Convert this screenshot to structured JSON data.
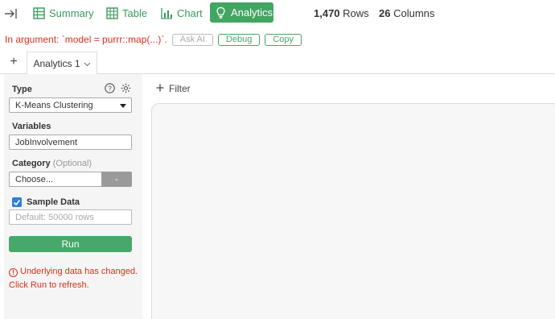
{
  "toolbar": {
    "collapse_icon": "collapse-right-icon",
    "views": [
      {
        "label": "Summary",
        "icon": "summary-icon"
      },
      {
        "label": "Table",
        "icon": "table-icon"
      },
      {
        "label": "Chart",
        "icon": "chart-icon"
      },
      {
        "label": "Analytics",
        "icon": "lightbulb-icon"
      }
    ],
    "rows_count": "1,470",
    "rows_label": "Rows",
    "cols_count": "26",
    "cols_label": "Columns",
    "accent_color": "#43a563"
  },
  "error": {
    "message": "In argument: `model = purrr::map(...)`.",
    "ask_ai_label": "Ask AI",
    "debug_label": "Debug",
    "copy_label": "Copy",
    "color": "#d7311d"
  },
  "tabs": {
    "add_label": "+",
    "items": [
      {
        "label": "Analytics 1"
      }
    ]
  },
  "panel": {
    "type_label": "Type",
    "type_value": "K-Means Clustering",
    "variables_label": "Variables",
    "variables_value": "JobInvolvement",
    "category_label": "Category",
    "category_optional": "(Optional)",
    "category_value": "Choose...",
    "category_minus": "-",
    "sample_label": "Sample Data",
    "sample_checked": true,
    "sample_placeholder": "Default: 50000 rows",
    "run_label": "Run",
    "warning": "Underlying data has changed. Click Run to refresh."
  },
  "main": {
    "filter_label": "Filter"
  }
}
